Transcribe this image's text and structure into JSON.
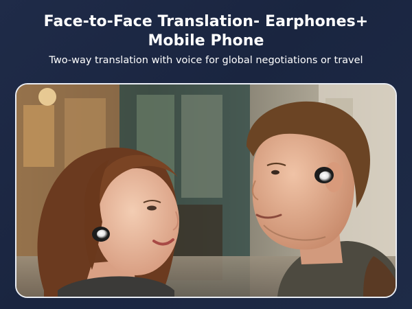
{
  "header": {
    "title_line1": "Face-to-Face Translation- Earphones+",
    "title_line2": "Mobile Phone",
    "subtitle": "Two-way translation with voice for global negotiations or travel"
  },
  "colors": {
    "background": "#1e2a45",
    "frame_border": "#e9edf5",
    "text": "#ffffff"
  }
}
